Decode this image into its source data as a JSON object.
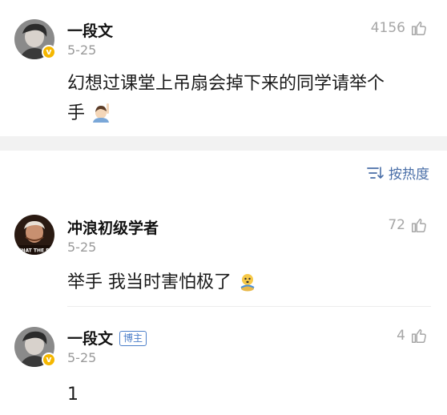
{
  "post": {
    "author": "一段文",
    "date": "5-25",
    "likes": "4156",
    "content_line1": "幻想过课堂上吊扇会掉下来的同学请举个",
    "content_line2": "手"
  },
  "sort": {
    "label": "按热度"
  },
  "comments": [
    {
      "author": "冲浪初级学者",
      "date": "5-25",
      "likes": "72",
      "content": "举手 我当时害怕极了",
      "avatar_caption": "WHAT THE FU"
    },
    {
      "author": "一段文",
      "badge": "博主",
      "date": "5-25",
      "likes": "4",
      "content": "1"
    }
  ],
  "colors": {
    "accent": "#4a6fa8",
    "verified": "#f5b700",
    "muted": "#9a9a9a"
  }
}
